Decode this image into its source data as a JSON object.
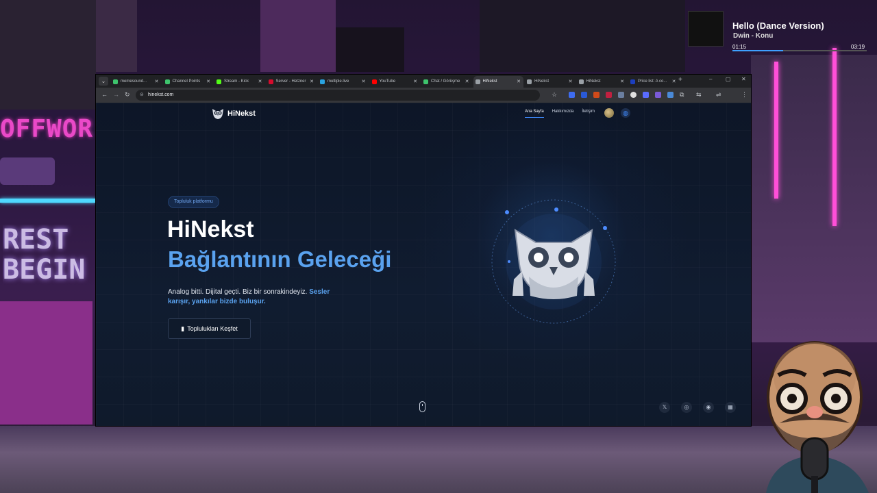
{
  "now_playing": {
    "title": "Hello (Dance Version)",
    "artist": "Dwin - Konu",
    "elapsed": "01:15",
    "total": "03:19",
    "progress": 0.377
  },
  "browser": {
    "tabs": [
      {
        "label": "memesound...",
        "color": "#3ec46d",
        "active": false
      },
      {
        "label": "Channel Points",
        "color": "#3ec46d",
        "active": false
      },
      {
        "label": "Stream - Kick",
        "color": "#53fc18",
        "active": false
      },
      {
        "label": "Server - Hetzner",
        "color": "#d50c2d",
        "active": false
      },
      {
        "label": "multiple.live",
        "color": "#2aa3e0",
        "active": false
      },
      {
        "label": "YouTube",
        "color": "#ff0000",
        "active": false
      },
      {
        "label": "Chat / Görüşme",
        "color": "#3ec46d",
        "active": false
      },
      {
        "label": "HiNekst",
        "color": "#9aa0a6",
        "active": true
      },
      {
        "label": "HiNekst",
        "color": "#9aa0a6",
        "active": false
      },
      {
        "label": "HiNekst",
        "color": "#9aa0a6",
        "active": false
      },
      {
        "label": "Price list: A co...",
        "color": "#1c3fbf",
        "active": false
      }
    ],
    "url": "hinekst.com"
  },
  "site": {
    "brand": "HiNekst",
    "nav": [
      {
        "label": "Ana Sayfa",
        "active": true
      },
      {
        "label": "Hakkımızda",
        "active": false
      },
      {
        "label": "İletişim",
        "active": false
      }
    ],
    "badge": "Topluluk platformu",
    "heading": "HiNekst",
    "subheading": "Bağlantının Geleceği",
    "lead_plain": "Analog bitti. Dijital geçti. Biz bir sonrakindeyiz. ",
    "lead_highlight": "Sesler karışır, yankılar bizde buluşur.",
    "cta": "Toplulukları Keşfet"
  }
}
